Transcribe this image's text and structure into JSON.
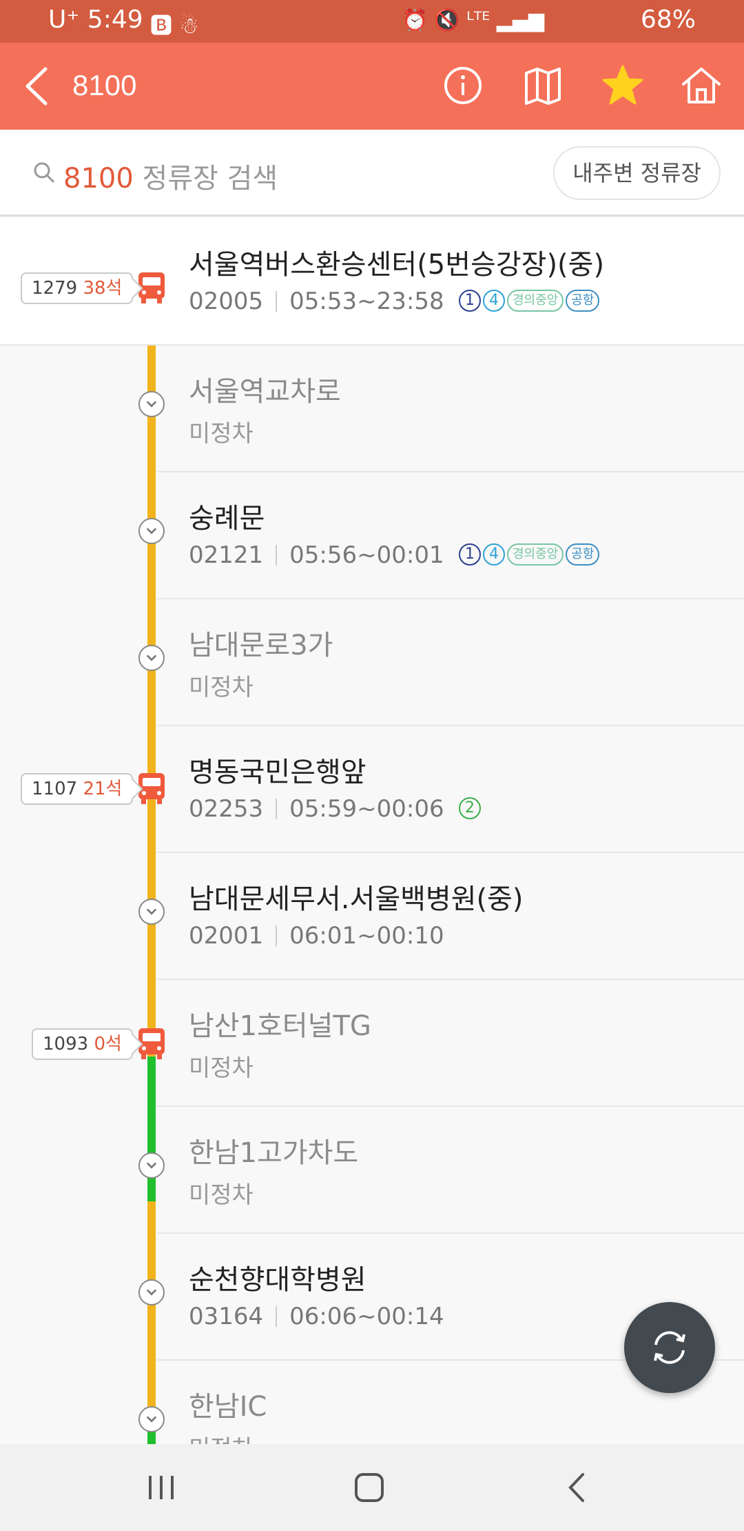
{
  "status_bar": {
    "carrier_time": "U⁺ 5:49",
    "battery": "68%"
  },
  "app_bar": {
    "route_number": "8100",
    "accent_color": "#f57059",
    "icons": [
      "info-icon",
      "map-icon",
      "star-icon",
      "home-icon"
    ]
  },
  "search": {
    "route": "8100",
    "placeholder": "정류장 검색",
    "nearby_label": "내주변 정류장"
  },
  "stops": [
    {
      "name": "서울역버스환승센터(5번승강장)(중)",
      "id": "02005",
      "hours": "05:53~23:58",
      "lines": [
        "1",
        "4",
        "경의중앙",
        "공항"
      ]
    },
    {
      "name": "서울역교차로",
      "status": "미정차"
    },
    {
      "name": "숭례문",
      "id": "02121",
      "hours": "05:56~00:01",
      "lines": [
        "1",
        "4",
        "경의중앙",
        "공항"
      ]
    },
    {
      "name": "남대문로3가",
      "status": "미정차"
    },
    {
      "name": "명동국민은행앞",
      "id": "02253",
      "hours": "05:59~00:06",
      "lines": [
        "2"
      ]
    },
    {
      "name": "남대문세무서.서울백병원(중)",
      "id": "02001",
      "hours": "06:01~00:10"
    },
    {
      "name": "남산1호터널TG",
      "status": "미정차"
    },
    {
      "name": "한남1고가차도",
      "status": "미정차"
    },
    {
      "name": "순천향대학병원",
      "id": "03164",
      "hours": "06:06~00:14"
    },
    {
      "name": "한남IC",
      "status": "미정차"
    }
  ],
  "buses": [
    {
      "number": "1279",
      "seats": "38석"
    },
    {
      "number": "1107",
      "seats": "21석"
    },
    {
      "number": "1093",
      "seats": "0석"
    }
  ],
  "colors": {
    "line_1": "#2a3f8f",
    "line_4": "#2ca2d6",
    "gyeongui": "#77c4a3",
    "airport": "#3b8ec2",
    "line_2": "#3aae47",
    "route_yellow": "#f2b41c",
    "route_green": "#1fbf2d"
  }
}
